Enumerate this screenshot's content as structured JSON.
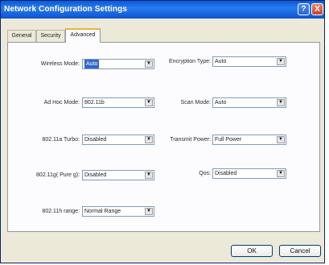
{
  "window": {
    "title": "Network Configuration Settings",
    "help_label": "?",
    "close_label": "X"
  },
  "tabs": [
    {
      "label": "General",
      "active": false
    },
    {
      "label": "Security",
      "active": false
    },
    {
      "label": "Advanced",
      "active": true
    }
  ],
  "left_settings": [
    {
      "label": "Wireless Mode:",
      "value": "Auto"
    },
    {
      "label": "Ad Hoc Mode:",
      "value": "802.11b"
    },
    {
      "label": "802.11a Turbo:",
      "value": "Disabled"
    },
    {
      "label": "802.11g( Pure g):",
      "value": "Disabled"
    },
    {
      "label": "802.11h range:",
      "value": "Normal Range"
    }
  ],
  "right_settings": [
    {
      "label": "Encryption Type:",
      "value": "Auto"
    },
    {
      "label": "Scan Mode:",
      "value": "Auto"
    },
    {
      "label": "Transmit Power:",
      "value": "Full Power"
    },
    {
      "label": "Qos:",
      "value": "Disabled"
    }
  ],
  "buttons": {
    "ok": "OK",
    "cancel": "Cancel"
  },
  "icons": {
    "dropdown_arrow": "▼"
  },
  "colors": {
    "title_bar": "#0a5ad8",
    "dialog_bg": "#ece9d8",
    "selection": "#3169c6"
  }
}
